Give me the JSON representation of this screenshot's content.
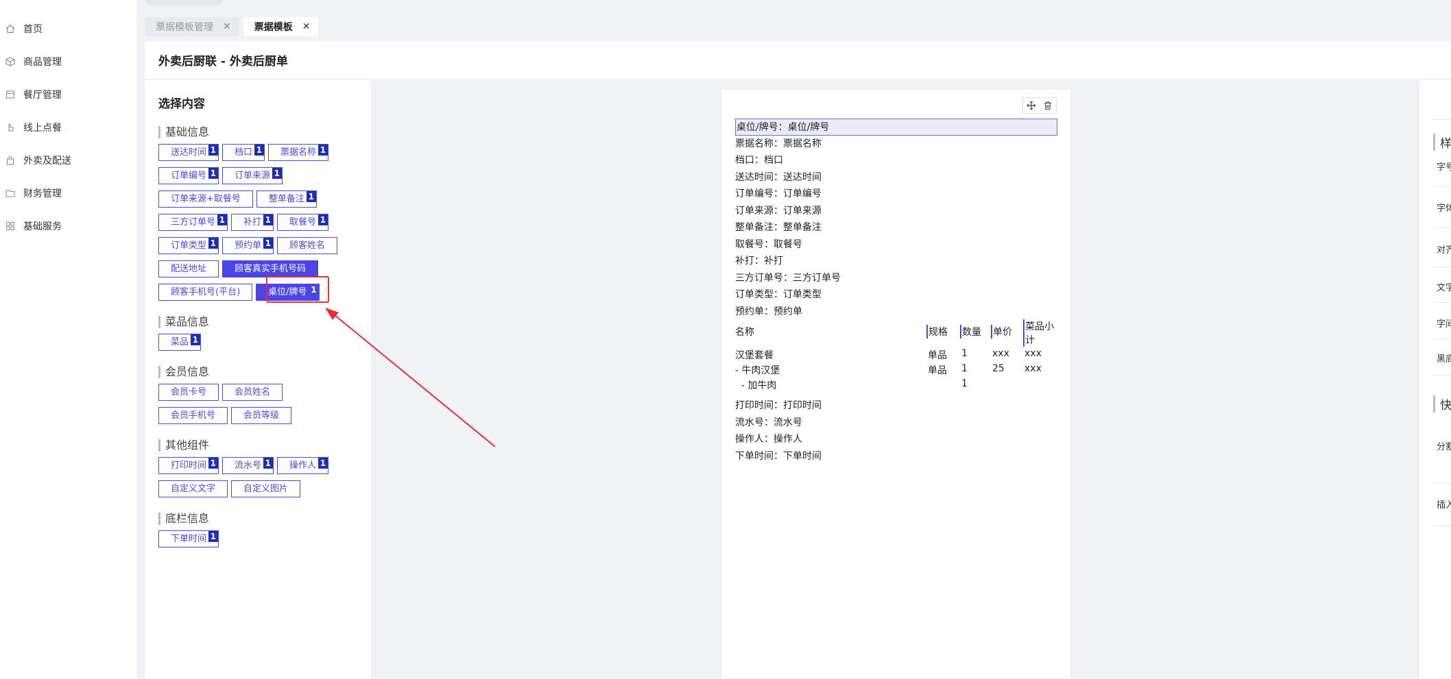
{
  "sidebar": {
    "items": [
      {
        "label": "首页",
        "icon": "home-icon"
      },
      {
        "label": "商品管理",
        "icon": "cube-icon"
      },
      {
        "label": "餐厅管理",
        "icon": "store-icon"
      },
      {
        "label": "线上点餐",
        "icon": "hand-icon"
      },
      {
        "label": "外卖及配送",
        "icon": "bag-icon"
      },
      {
        "label": "财务管理",
        "icon": "folder-icon"
      },
      {
        "label": "基础服务",
        "icon": "grid-icon"
      }
    ]
  },
  "tabs": [
    {
      "label": "票据模板管理",
      "active": false
    },
    {
      "label": "票据模板",
      "active": true
    }
  ],
  "header": {
    "title": "外卖后厨联 - 外卖后厨单"
  },
  "left": {
    "title": "选择内容",
    "groups": [
      {
        "title": "基础信息"
      },
      {
        "title": "菜品信息"
      },
      {
        "title": "会员信息"
      },
      {
        "title": "其他组件"
      },
      {
        "title": "底栏信息"
      }
    ],
    "basic": {
      "b1": "送达时间",
      "b2": "档口",
      "b3": "票据名称",
      "b4": "订单编号",
      "b5": "订单来源",
      "b6": "订单来源+取餐号",
      "b7": "整单备注",
      "b8": "三方订单号",
      "b9": "补打",
      "b10": "取餐号",
      "b11": "订单类型",
      "b12": "预约单",
      "b13": "顾客姓名",
      "b14": "配送地址",
      "b15": "顾客真实手机号码",
      "b16": "顾客手机号(平台)",
      "b17": "桌位/牌号"
    },
    "dish": {
      "d1": "菜品"
    },
    "member": {
      "m1": "会员卡号",
      "m2": "会员姓名",
      "m3": "会员手机号",
      "m4": "会员等级"
    },
    "other": {
      "o1": "打印时间",
      "o2": "流水号",
      "o3": "操作人",
      "o4": "自定义文字",
      "o5": "自定义图片"
    },
    "footer": {
      "f1": "下单时间"
    },
    "badge": "1"
  },
  "preview": {
    "lines_top": [
      "桌位/牌号：桌位/牌号",
      "票据名称：票据名称",
      "档口：档口",
      "送达时间：送达时间",
      "订单编号：订单编号",
      "订单来源：订单来源",
      "整单备注：整单备注",
      "取餐号：取餐号",
      "补打：补打",
      "三方订单号：三方订单号",
      "订单类型：订单类型",
      "预约单：预约单"
    ],
    "table": {
      "headers": {
        "name": "名称",
        "spec": "规格",
        "qty": "数量",
        "price": "单价",
        "subtotal_1": "菜品小",
        "subtotal_2": "计"
      },
      "rows": [
        {
          "name": "汉堡套餐",
          "spec": "单品",
          "qty": "1",
          "price": "xxx",
          "subtotal": "xxx"
        },
        {
          "name": "- 牛肉汉堡",
          "spec": "单品",
          "qty": "1",
          "price": "25",
          "subtotal": "xxx"
        },
        {
          "name": "  - 加牛肉",
          "spec": "",
          "qty": "1",
          "price": "",
          "subtotal": ""
        }
      ]
    },
    "lines_bottom": [
      "打印时间：打印时间",
      "流水号：流水号",
      "操作人：操作人",
      "下单时间：下单时间"
    ]
  },
  "right": {
    "title1": "样",
    "labels": [
      "字号",
      "字体",
      "对齐",
      "文字",
      "字间",
      "黑底"
    ],
    "title2": "快",
    "labels2": [
      "分割",
      "插入"
    ]
  },
  "colors": {
    "accent": "#4b45e8",
    "badge": "#1c2db8",
    "highlight": "#e83030"
  }
}
